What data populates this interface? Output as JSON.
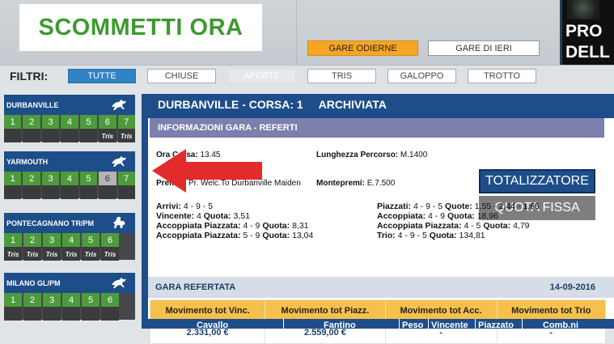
{
  "header": {
    "logo": "SCOMMETTI ORA",
    "buttons": {
      "today": "GARE ODIERNE",
      "yesterday": "GARE DI IERI"
    },
    "promo_text": "PRO\nDELL"
  },
  "filters": {
    "label": "FILTRI:",
    "options": [
      "TUTTE",
      "CHIUSE",
      "APERTE",
      "TRIS",
      "GALOPPO",
      "TROTTO"
    ],
    "active": "TUTTE"
  },
  "sidebar": [
    {
      "name": "DURBANVILLE",
      "type": "galoppo",
      "races": [
        "1",
        "2",
        "3",
        "4",
        "5",
        "6",
        "7"
      ],
      "tags": [
        "",
        "",
        "",
        "",
        "",
        "Tris",
        "Tris"
      ],
      "selected": ""
    },
    {
      "name": "YARMOUTH",
      "type": "galoppo",
      "races": [
        "1",
        "2",
        "3",
        "4",
        "5",
        "6",
        "7"
      ],
      "tags": [
        "",
        "",
        "",
        "",
        "",
        "",
        ""
      ],
      "selected": "6"
    },
    {
      "name": "PONTECAGNANO TR/PM",
      "type": "trotto",
      "races": [
        "1",
        "2",
        "3",
        "4",
        "5",
        "6"
      ],
      "tags": [
        "Tris",
        "Tris",
        "Tris",
        "Tris",
        "Tris",
        "Tris"
      ],
      "selected": ""
    },
    {
      "name": "MILANO GL/PM",
      "type": "galoppo",
      "races": [
        "1",
        "2",
        "3",
        "4",
        "5",
        "6"
      ],
      "tags": [
        "",
        "",
        "",
        "",
        "",
        ""
      ],
      "selected": ""
    }
  ],
  "main": {
    "title": "DURBANVILLE - CORSA: 1     ARCHIVIATA",
    "info_header": "INFORMAZIONI GARA - REFERTI",
    "ora_label": "Ora Corsa:",
    "ora_value": "13.45",
    "lunghezza_label": "Lunghezza Percorso:",
    "lunghezza_value": "M.1400",
    "premio_label": "Premio:",
    "premio_value": "Pr. Welc.To Durbanville Maiden",
    "montepremi_label": "Montepremi:",
    "montepremi_value": "E.7.500",
    "btn_totalizzatore": "TOTALIZZATORE",
    "btn_quota_fissa": "QUOTA FISSA",
    "results_left": [
      {
        "label": "Arrivi:",
        "value": "4 - 9 - 5",
        "qlabel": "",
        "qvalue": ""
      },
      {
        "label": "Vincente:",
        "value": "4",
        "qlabel": "Quota:",
        "qvalue": "3,51"
      },
      {
        "label": "Accoppiata Piazzata:",
        "value": "4 - 9",
        "qlabel": "Quota:",
        "qvalue": "8,31"
      },
      {
        "label": "Accoppiata Piazzata:",
        "value": "5 - 9",
        "qlabel": "Quota:",
        "qvalue": "13,04"
      }
    ],
    "results_right": [
      {
        "label": "Piazzati:",
        "value": "4 - 9 - 5",
        "qlabel": "Quote:",
        "qvalue": "1,55 - 2,44 - 1,65"
      },
      {
        "label": "Accoppiata:",
        "value": "4 - 9",
        "qlabel": "Quota:",
        "qvalue": "18,96"
      },
      {
        "label": "Accoppiata Piazzata:",
        "value": "4 - 5",
        "qlabel": "Quota:",
        "qvalue": "4,79"
      },
      {
        "label": "Trio:",
        "value": "4 - 9 - 5",
        "qlabel": "Quota:",
        "qvalue": "134,81"
      }
    ],
    "refertata_label": "GARA REFERTATA",
    "refertata_date": "14-09-2016",
    "movimenti": {
      "headers": [
        "Movimento tot Vinc.",
        "Movimento tot Piazz.",
        "Movimento tot Acc.",
        "Movimento tot Trio"
      ],
      "values": [
        "2.331,00 €",
        "2.559,00 €",
        "-",
        "-"
      ]
    },
    "runners_headers": [
      "Cavallo",
      "Fantino",
      "Peso",
      "Vincente",
      "Piazzato",
      "Comb.ni"
    ]
  },
  "colors": {
    "navy": "#1d4e8a",
    "green": "#4d9b3c",
    "orange": "#f6a623",
    "accent_red": "#e32b2b"
  }
}
